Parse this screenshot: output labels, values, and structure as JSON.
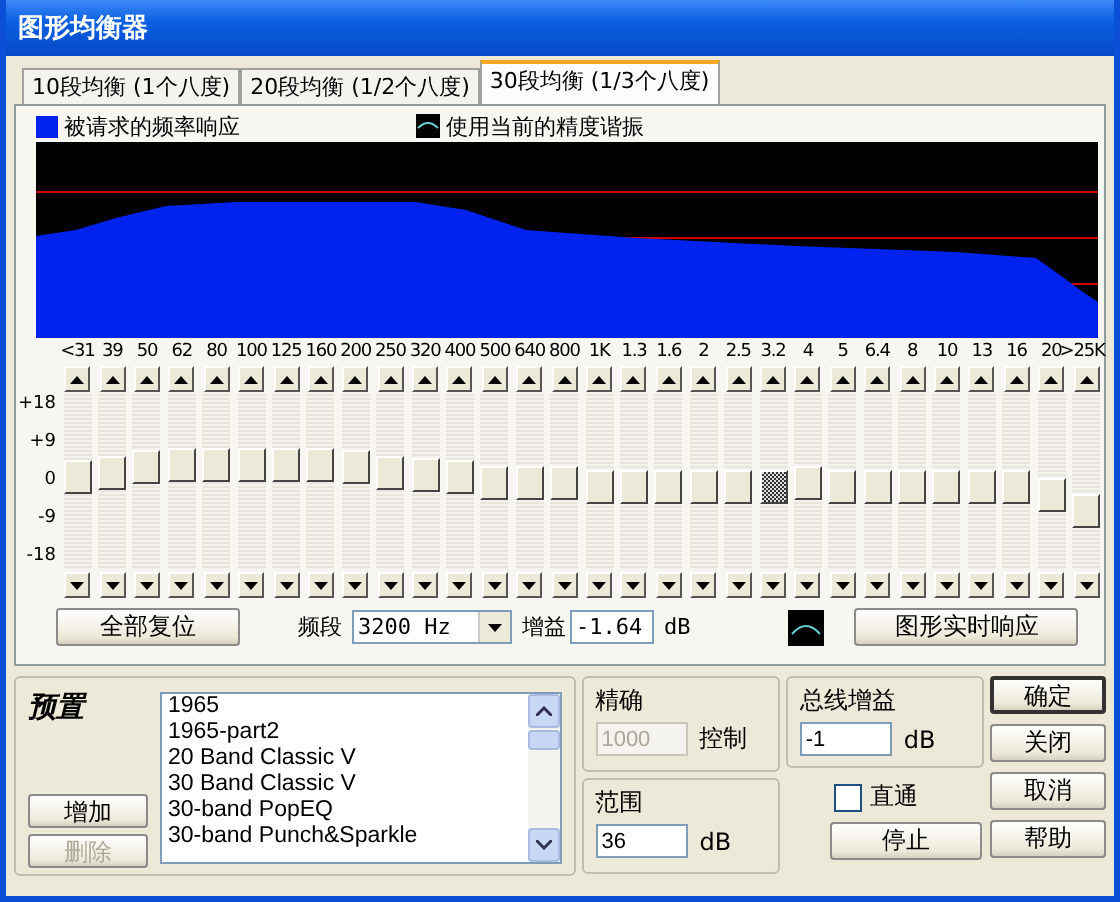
{
  "window": {
    "title": "图形均衡器"
  },
  "tabs": [
    {
      "label": "10段均衡 (1个八度)",
      "selected": false
    },
    {
      "label": "20段均衡 (1/2个八度)",
      "selected": false
    },
    {
      "label": "30段均衡 (1/3个八度)",
      "selected": true
    }
  ],
  "legend": [
    {
      "label": "被请求的频率响应",
      "kind": "fill"
    },
    {
      "label": "使用当前的精度谐振",
      "kind": "curve"
    }
  ],
  "scale_labels": [
    "+18",
    "+9",
    "0",
    "-9",
    "-18"
  ],
  "bands": [
    {
      "label": "<31",
      "level": 0.53,
      "selected": false
    },
    {
      "label": "39",
      "level": 0.56,
      "selected": false
    },
    {
      "label": "50",
      "level": 0.6,
      "selected": false
    },
    {
      "label": "62",
      "level": 0.62,
      "selected": false
    },
    {
      "label": "80",
      "level": 0.62,
      "selected": false
    },
    {
      "label": "100",
      "level": 0.62,
      "selected": false
    },
    {
      "label": "125",
      "level": 0.62,
      "selected": false
    },
    {
      "label": "160",
      "level": 0.62,
      "selected": false
    },
    {
      "label": "200",
      "level": 0.6,
      "selected": false
    },
    {
      "label": "250",
      "level": 0.56,
      "selected": false
    },
    {
      "label": "320",
      "level": 0.55,
      "selected": false
    },
    {
      "label": "400",
      "level": 0.54,
      "selected": false
    },
    {
      "label": "500",
      "level": 0.5,
      "selected": false
    },
    {
      "label": "640",
      "level": 0.5,
      "selected": false
    },
    {
      "label": "800",
      "level": 0.49,
      "selected": false
    },
    {
      "label": "1K",
      "level": 0.47,
      "selected": false
    },
    {
      "label": "1.3",
      "level": 0.47,
      "selected": false
    },
    {
      "label": "1.6",
      "level": 0.47,
      "selected": false
    },
    {
      "label": "2",
      "level": 0.47,
      "selected": false
    },
    {
      "label": "2.5",
      "level": 0.47,
      "selected": false
    },
    {
      "label": "3.2",
      "level": 0.47,
      "selected": true
    },
    {
      "label": "4",
      "level": 0.5,
      "selected": false
    },
    {
      "label": "5",
      "level": 0.46,
      "selected": false
    },
    {
      "label": "6.4",
      "level": 0.46,
      "selected": false
    },
    {
      "label": "8",
      "level": 0.46,
      "selected": false
    },
    {
      "label": "10",
      "level": 0.46,
      "selected": false
    },
    {
      "label": "13",
      "level": 0.46,
      "selected": false
    },
    {
      "label": "16",
      "level": 0.46,
      "selected": false
    },
    {
      "label": "20",
      "level": 0.41,
      "selected": false
    },
    {
      "label": ">25K",
      "level": 0.3,
      "selected": false
    }
  ],
  "controls": {
    "reset_button": "全部复位",
    "band_label": "频段",
    "band_value": "3200 Hz",
    "gain_label": "增益",
    "gain_value": "-1.64",
    "gain_unit": "dB",
    "response_button": "图形实时响应"
  },
  "presets": {
    "title": "预置",
    "items": [
      "1965",
      "1965-part2",
      "20 Band Classic V",
      "30 Band Classic V",
      "30-band PopEQ",
      "30-band Punch&Sparkle"
    ],
    "add_button": "增加",
    "delete_button": {
      "label": "删除",
      "disabled": true
    }
  },
  "precision": {
    "title": "精确",
    "value": "1000",
    "disabled": true,
    "unit": "控制"
  },
  "range": {
    "title": "范围",
    "value": "36",
    "unit": "dB"
  },
  "master_gain": {
    "title": "总线增益",
    "value": "-1",
    "unit": "dB"
  },
  "bypass": {
    "label": "直通",
    "checked": false
  },
  "buttons": [
    {
      "label": "确定",
      "default": true
    },
    {
      "label": "关闭",
      "default": false
    },
    {
      "label": "取消",
      "default": false
    },
    {
      "label": "帮助",
      "default": false
    }
  ],
  "stop_button": "停止"
}
